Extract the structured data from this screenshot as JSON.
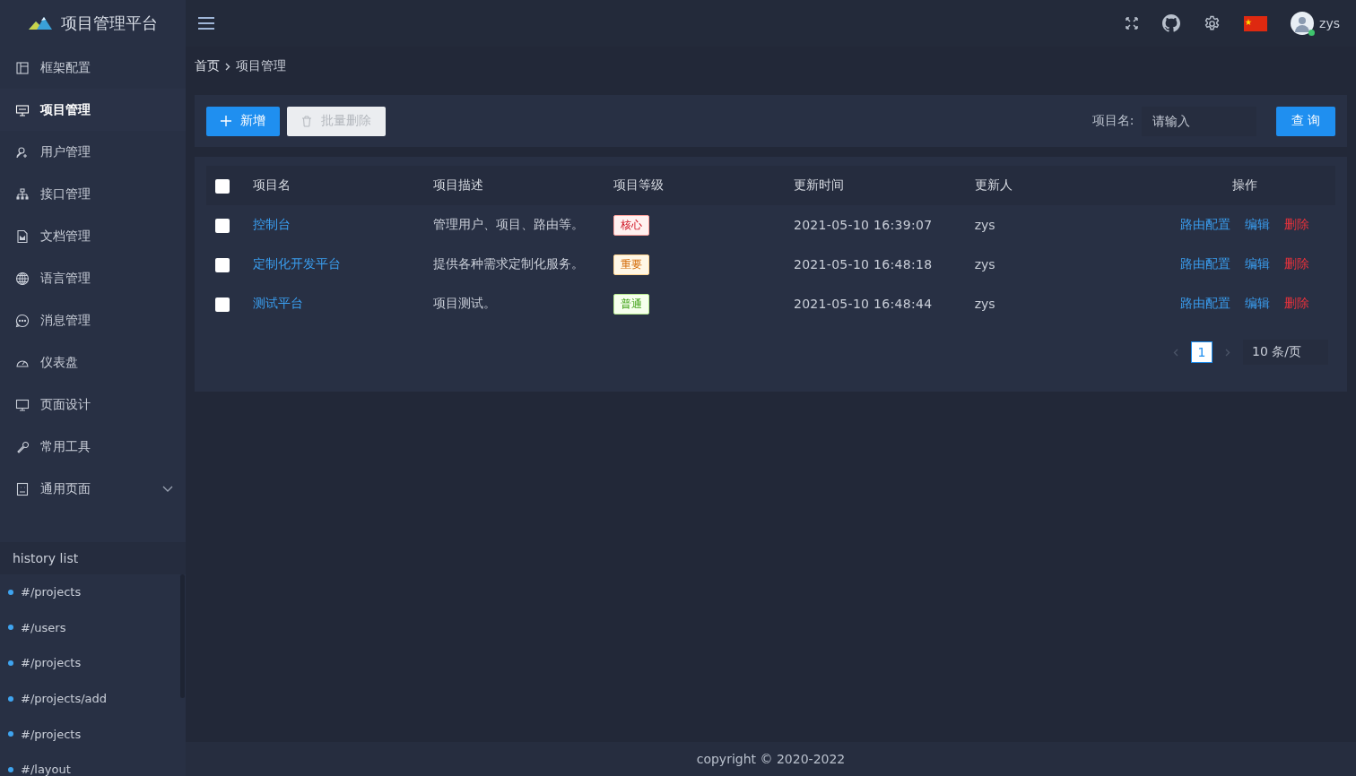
{
  "brand": {
    "title": "项目管理平台"
  },
  "header": {
    "user": "zys",
    "online": true
  },
  "sidebar": {
    "items": [
      {
        "label": "框架配置",
        "kind": "link",
        "selected": false
      },
      {
        "label": "项目管理",
        "kind": "link",
        "selected": true
      },
      {
        "label": "用户管理",
        "kind": "link",
        "selected": false
      },
      {
        "label": "接口管理",
        "kind": "link",
        "selected": false
      },
      {
        "label": "文档管理",
        "kind": "link",
        "selected": false
      },
      {
        "label": "语言管理",
        "kind": "link",
        "selected": false
      },
      {
        "label": "消息管理",
        "kind": "link",
        "selected": false
      },
      {
        "label": "仪表盘",
        "kind": "link",
        "selected": false
      },
      {
        "label": "页面设计",
        "kind": "link",
        "selected": false
      },
      {
        "label": "常用工具",
        "kind": "link",
        "selected": false
      },
      {
        "label": "通用页面",
        "kind": "submenu",
        "selected": false,
        "expanded": false
      }
    ]
  },
  "history": {
    "title": "history list",
    "items": [
      "#/projects",
      "#/users",
      "#/projects",
      "#/projects/add",
      "#/projects",
      "#/layout"
    ]
  },
  "breadcrumb": [
    "首页",
    "项目管理"
  ],
  "toolbar": {
    "add": "新增",
    "batch_delete": {
      "label": "批量删除",
      "disabled": true
    },
    "filter_label": "项目名:",
    "filter_placeholder": "请输入",
    "search": "查 询"
  },
  "table": {
    "all_checked": false,
    "columns": [
      "项目名",
      "项目描述",
      "项目等级",
      "更新时间",
      "更新人",
      "操作"
    ],
    "rows": [
      {
        "checked": false,
        "name": "控制台",
        "description": "管理用户、项目、路由等。",
        "grade": {
          "label": "核心",
          "kind": "danger"
        },
        "updated": "2021-05-10 16:39:07",
        "updater": "zys",
        "actions": [
          "路由配置",
          "编辑",
          "删除"
        ]
      },
      {
        "checked": false,
        "name": "定制化开发平台",
        "description": "提供各种需求定制化服务。",
        "grade": {
          "label": "重要",
          "kind": "warning"
        },
        "updated": "2021-05-10 16:48:18",
        "updater": "zys",
        "actions": [
          "路由配置",
          "编辑",
          "删除"
        ]
      },
      {
        "checked": false,
        "name": "测试平台",
        "description": "项目测试。",
        "grade": {
          "label": "普通",
          "kind": "success"
        },
        "updated": "2021-05-10 16:48:44",
        "updater": "zys",
        "actions": [
          "路由配置",
          "编辑",
          "删除"
        ]
      }
    ]
  },
  "pagination": {
    "pages": [
      {
        "label": "1",
        "selected": true
      }
    ],
    "page_size": "10 条/页"
  },
  "footer": {
    "copyright": "copyright © 2020-2022"
  }
}
